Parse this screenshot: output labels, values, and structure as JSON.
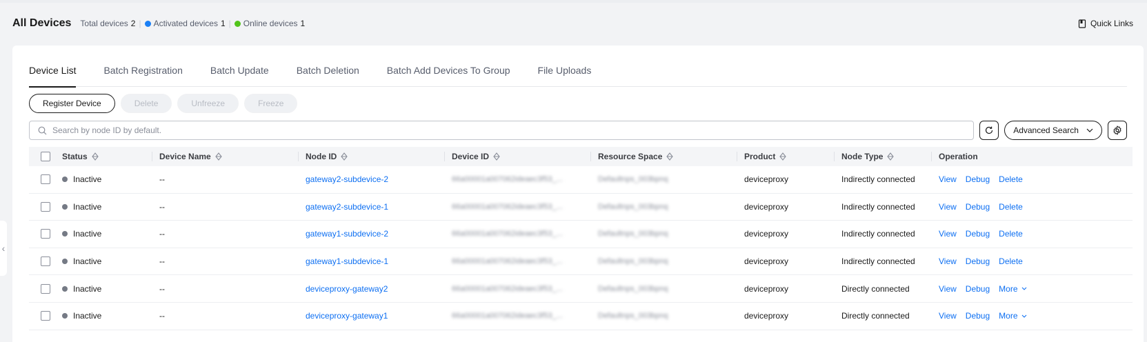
{
  "header": {
    "title": "All Devices",
    "total_label": "Total devices",
    "total_count": "2",
    "activated_label": "Activated devices",
    "activated_count": "1",
    "online_label": "Online devices",
    "online_count": "1",
    "activated_color": "#1a7ff5",
    "online_color": "#52c41a",
    "separator": "|",
    "quick_links": "Quick Links"
  },
  "tabs": [
    {
      "label": "Device List",
      "active": true
    },
    {
      "label": "Batch Registration"
    },
    {
      "label": "Batch Update"
    },
    {
      "label": "Batch Deletion"
    },
    {
      "label": "Batch Add Devices To Group"
    },
    {
      "label": "File Uploads"
    }
  ],
  "toolbar": {
    "register": "Register Device",
    "delete": "Delete",
    "unfreeze": "Unfreeze",
    "freeze": "Freeze"
  },
  "search": {
    "placeholder": "Search by node ID by default.",
    "advanced": "Advanced Search"
  },
  "table": {
    "columns": {
      "status": "Status",
      "name": "Device Name",
      "node": "Node ID",
      "device": "Device ID",
      "space": "Resource Space",
      "product": "Product",
      "type": "Node Type",
      "op": "Operation"
    },
    "rows": [
      {
        "status": "Inactive",
        "name": "--",
        "node": "gateway2-subdevice-2",
        "device": "66a00001a007062ideaec3f53_...",
        "space": "Defaultnps_003bpnq",
        "product": "deviceproxy",
        "type": "Indirectly connected",
        "op3": "Delete"
      },
      {
        "status": "Inactive",
        "name": "--",
        "node": "gateway2-subdevice-1",
        "device": "66a00001a007062ideaec3f53_...",
        "space": "Defaultnps_003bpnq",
        "product": "deviceproxy",
        "type": "Indirectly connected",
        "op3": "Delete"
      },
      {
        "status": "Inactive",
        "name": "--",
        "node": "gateway1-subdevice-2",
        "device": "66a00001a007062ideaec3f53_...",
        "space": "Defaultnps_003bpnq",
        "product": "deviceproxy",
        "type": "Indirectly connected",
        "op3": "Delete"
      },
      {
        "status": "Inactive",
        "name": "--",
        "node": "gateway1-subdevice-1",
        "device": "66a00001a007062ideaec3f53_...",
        "space": "Defaultnps_003bpnq",
        "product": "deviceproxy",
        "type": "Indirectly connected",
        "op3": "Delete"
      },
      {
        "status": "Inactive",
        "name": "--",
        "node": "deviceproxy-gateway2",
        "device": "66a00001a007062ideaec3f53_...",
        "space": "Defaultnps_003bpnq",
        "product": "deviceproxy",
        "type": "Directly connected",
        "op3": "More"
      },
      {
        "status": "Inactive",
        "name": "--",
        "node": "deviceproxy-gateway1",
        "device": "66a00001a007062ideaec3f53_...",
        "space": "Defaultnps_003bpnq",
        "product": "deviceproxy",
        "type": "Directly connected",
        "op3": "More"
      }
    ],
    "op_view": "View",
    "op_debug": "Debug"
  }
}
